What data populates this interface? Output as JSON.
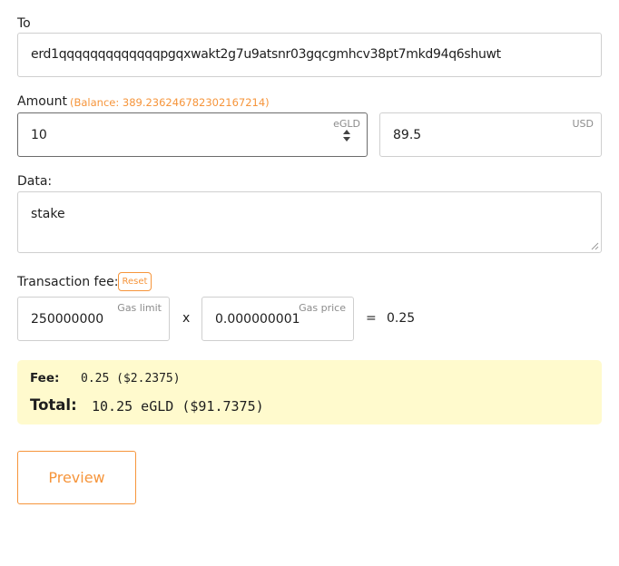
{
  "to": {
    "label": "To",
    "value": "erd1qqqqqqqqqqqqqpgqxwakt2g7u9atsnr03gqcgmhcv38pt7mkd94q6shuwt"
  },
  "amount": {
    "label": "Amount",
    "balance": "(Balance: 389.236246782302167214)",
    "value": "10",
    "unit": "eGLD",
    "usd_value": "89.5",
    "usd_unit": "USD"
  },
  "data_field": {
    "label": "Data:",
    "value": "stake"
  },
  "fee": {
    "label": "Transaction fee:",
    "reset_label": "Reset",
    "gas_limit": "250000000",
    "gas_limit_label": "Gas limit",
    "multiply": "x",
    "gas_price": "0.000000001",
    "gas_price_label": "Gas price",
    "equals": "=",
    "result": "0.25"
  },
  "summary": {
    "fee_label": "Fee:",
    "fee_value": "0.25 ($2.2375)",
    "total_label": "Total:",
    "total_value": "10.25 eGLD ($91.7375)"
  },
  "preview_button": {
    "label": "Preview"
  },
  "colors": {
    "accent": "#f6953b",
    "summary_bg": "#fffacd"
  }
}
